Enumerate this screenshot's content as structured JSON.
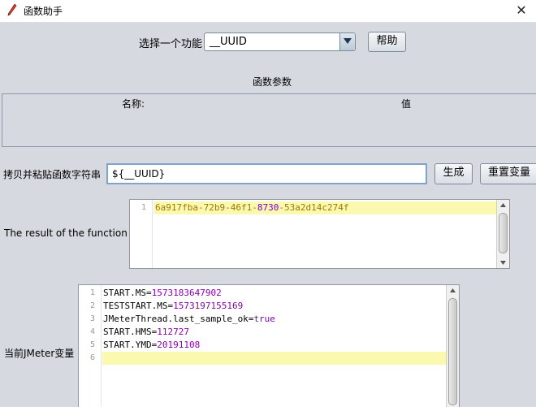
{
  "window": {
    "title": "函数助手",
    "close_glyph": "✕"
  },
  "function_select": {
    "label": "选择一个功能",
    "selected": "__UUID",
    "help_button": "帮助"
  },
  "params": {
    "title": "函数参数",
    "columns": [
      "名称:",
      "值"
    ]
  },
  "function_string": {
    "label": "拷贝并粘贴函数字符串",
    "value": "${__UUID}",
    "generate_button": "生成",
    "reset_button": "重置变量"
  },
  "result": {
    "label": "The result of the function is",
    "lines": [
      {
        "num": "1",
        "parts": [
          {
            "t": "6a917fba-72b9-46f1-",
            "c": "hex"
          },
          {
            "t": "8730",
            "c": "num"
          },
          {
            "t": "-53a2d14c274f",
            "c": "hex"
          }
        ]
      }
    ]
  },
  "jmeter_vars": {
    "label": "当前JMeter变量",
    "lines": [
      {
        "num": "1",
        "key": "START.MS",
        "value": "1573183647902",
        "kind": "num"
      },
      {
        "num": "2",
        "key": "TESTSTART.MS",
        "value": "1573197155169",
        "kind": "num"
      },
      {
        "num": "3",
        "key": "JMeterThread.last_sample_ok",
        "value": "true",
        "kind": "kw"
      },
      {
        "num": "4",
        "key": "START.HMS",
        "value": "112727",
        "kind": "num"
      },
      {
        "num": "5",
        "key": "START.YMD",
        "value": "20191108",
        "kind": "num"
      },
      {
        "num": "6",
        "key": "",
        "value": "",
        "kind": "num"
      }
    ]
  },
  "icons": {
    "app": "pencil-icon",
    "dropdown": "chevron-down-icon",
    "close": "close-icon"
  }
}
